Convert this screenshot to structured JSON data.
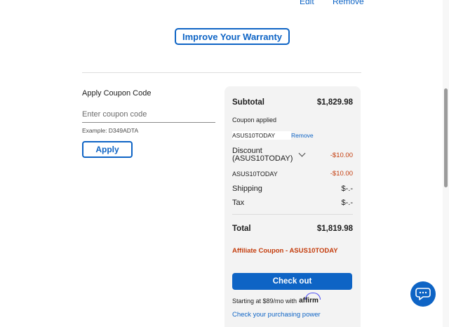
{
  "item_actions": {
    "edit_label": "Edit",
    "remove_label": "Remove"
  },
  "warranty": {
    "button_label": "Improve Your Warranty"
  },
  "coupon": {
    "title": "Apply Coupon Code",
    "placeholder": "Enter coupon code",
    "example": "Example: D349ADTA",
    "apply_label": "Apply"
  },
  "summary": {
    "subtotal_label": "Subtotal",
    "subtotal_value": "$1,829.98",
    "coupon_applied_label": "Coupon applied",
    "coupon_code": "ASUS10TODAY",
    "coupon_remove_label": "Remove",
    "discount_label": "Discount (ASUS10TODAY)",
    "discount_value": "-$10.00",
    "discount_line_code": "ASUS10TODAY",
    "discount_line_value": "-$10.00",
    "shipping_label": "Shipping",
    "shipping_value": "$-.-",
    "tax_label": "Tax",
    "tax_value": "$-.-",
    "total_label": "Total",
    "total_value": "$1,819.98",
    "affiliate_text": "Affiliate Coupon - ASUS10TODAY",
    "checkout_label": "Check out",
    "affirm_text": "Starting at $89/mo with",
    "affirm_logo": "affirm",
    "purchasing_power_link": "Check your purchasing power"
  },
  "colors": {
    "accent": "#0e64c5",
    "discount": "#c43c0c",
    "panel": "#f3f3f3"
  },
  "icons": {
    "chat": "chat-bubble-icon",
    "discount_toggle": "chevron-down-icon"
  }
}
